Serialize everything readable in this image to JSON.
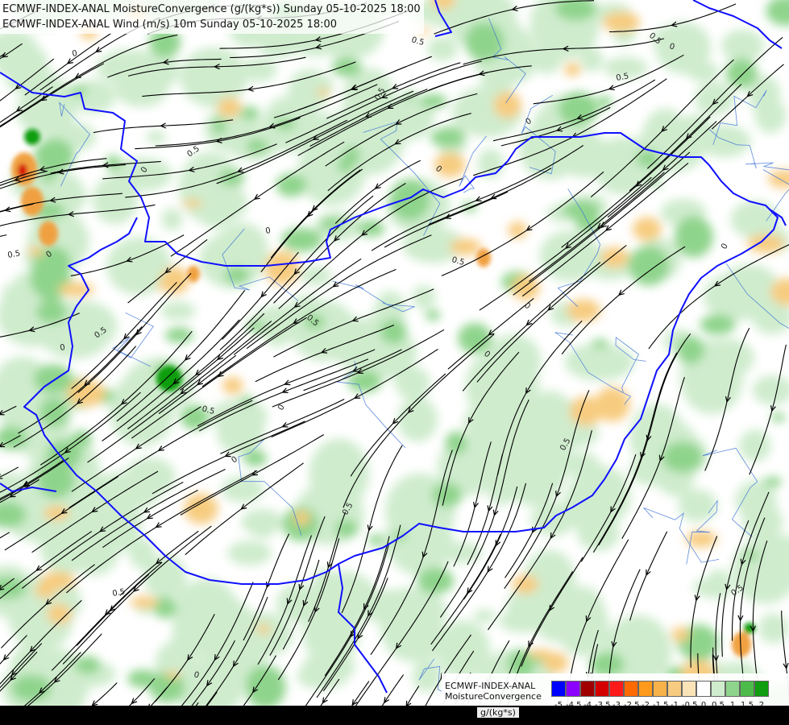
{
  "titles": {
    "line1": "ECMWF-INDEX-ANAL MoistureConvergence (g/(kg*s)) Sunday 05-10-2025 18:00",
    "line2": "ECMWF-INDEX-ANAL Wind (m/s) 10m Sunday 05-10-2025 18:00"
  },
  "legend": {
    "label_line1": "ECMWF-INDEX-ANAL",
    "label_line2": "MoistureConvergence",
    "units": "g/(kg*s)",
    "bins": [
      {
        "label": "-5",
        "color": "#0000ff"
      },
      {
        "label": "-4.5",
        "color": "#8b00ff"
      },
      {
        "label": "-4",
        "color": "#a00000"
      },
      {
        "label": "-3.5",
        "color": "#d40000"
      },
      {
        "label": "-3",
        "color": "#ff1a1a"
      },
      {
        "label": "-2.5",
        "color": "#ff6a00"
      },
      {
        "label": "-2",
        "color": "#ff9a1a"
      },
      {
        "label": "-1.5",
        "color": "#f7b24a"
      },
      {
        "label": "-1",
        "color": "#f7cc80"
      },
      {
        "label": "-0.5",
        "color": "#fbe3b8"
      },
      {
        "label": "0",
        "color": "#ffffff"
      },
      {
        "label": "0.5",
        "color": "#cfeccd"
      },
      {
        "label": "1",
        "color": "#8fd48c"
      },
      {
        "label": "1.5",
        "color": "#4dbb4a"
      },
      {
        "label": "2",
        "color": "#109d10"
      }
    ]
  },
  "contour_labels": [
    "0",
    "0.5"
  ],
  "colors": {
    "border": "#1010ff",
    "river": "#3a6fd8",
    "streamline": "#000000",
    "green_light": "#cfeccd",
    "green_mid": "#8fd48c",
    "green_dark": "#109d10",
    "orange_light": "#f7cc80",
    "orange_mid": "#f0a040",
    "red": "#d40000"
  }
}
